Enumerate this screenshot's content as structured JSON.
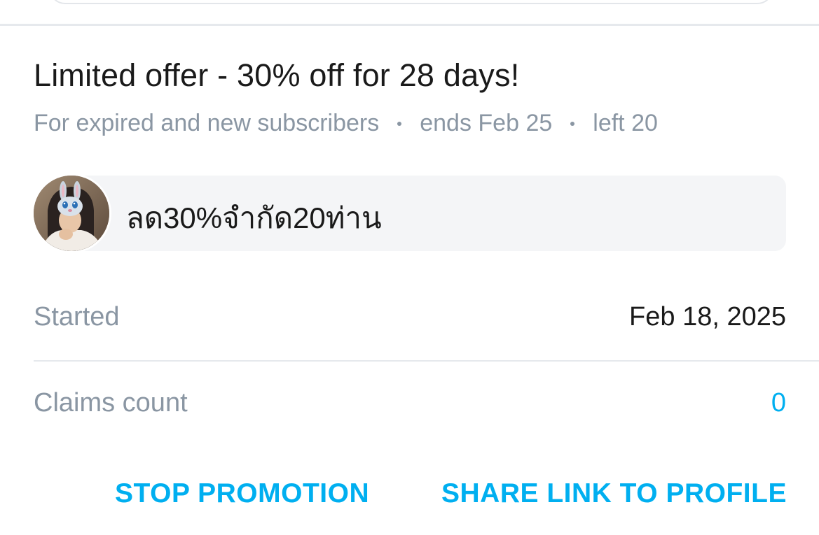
{
  "offer": {
    "title": "Limited offer - 30% off for 28 days!",
    "audience": "For expired and new subscribers",
    "ends": "ends Feb 25",
    "left": "left 20",
    "message": "ลด30%จำกัด20ท่าน"
  },
  "details": {
    "started_label": "Started",
    "started_value": "Feb 18, 2025",
    "claims_label": "Claims count",
    "claims_value": "0"
  },
  "actions": {
    "stop_label": "STOP PROMOTION",
    "share_label": "SHARE LINK TO PROFILE"
  },
  "colors": {
    "accent": "#00aff0",
    "muted_text": "#8a96a3",
    "primary_text": "#1a1a1a",
    "bubble_bg": "#f4f5f7"
  }
}
